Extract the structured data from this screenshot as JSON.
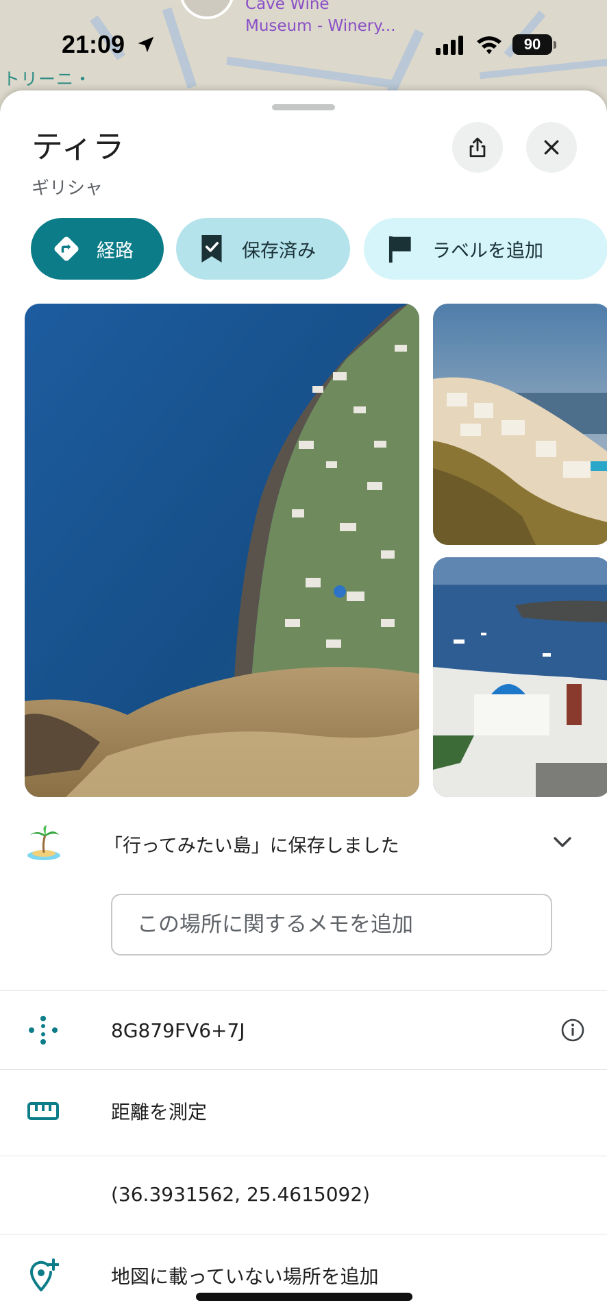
{
  "status_bar": {
    "time": "21:09",
    "battery": "90"
  },
  "map": {
    "poi_label_line1": "Cave Wine",
    "poi_label_line2": "Museum - Winery...",
    "town_label": "トリーニ・"
  },
  "place": {
    "title": "ティラ",
    "subtitle": "ギリシャ"
  },
  "chips": {
    "route": "経路",
    "saved": "保存済み",
    "add_label": "ラベルを追加"
  },
  "saved_list": {
    "emoji": "🏝️",
    "text": "「行ってみたい島」に保存しました"
  },
  "memo": {
    "placeholder": "この場所に関するメモを追加",
    "value": ""
  },
  "rows": {
    "plus_code": "8G879FV6+7J",
    "measure": "距離を測定",
    "coordinates": "(36.3931562, 25.4615092)",
    "add_missing_place": "地図に載っていない場所を追加"
  },
  "colors": {
    "accent": "#0b7c88",
    "chip_saved": "#b5e3ec",
    "chip_light": "#d6f5fa",
    "poi_text": "#8a4fc7"
  }
}
